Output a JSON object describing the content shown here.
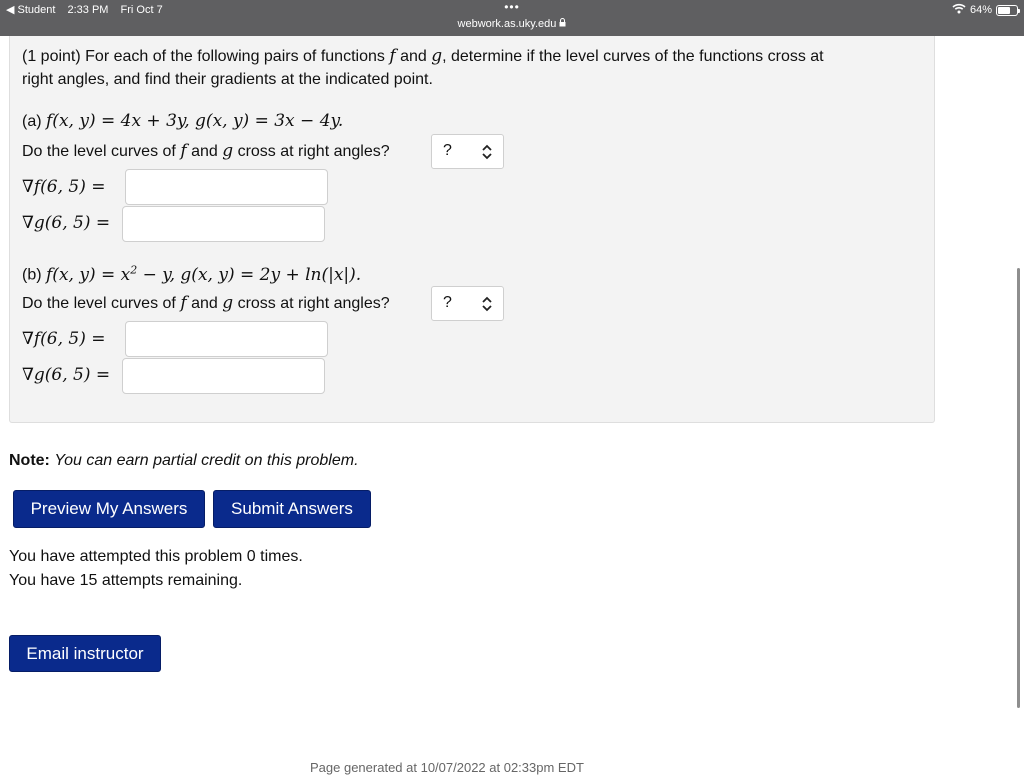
{
  "status_bar": {
    "back_label": "◀ Student",
    "time": "2:33 PM",
    "date": "Fri Oct 7",
    "dots": "•••",
    "url": "webwork.as.uky.edu",
    "lock": "🔒",
    "battery": "64%",
    "battery_level": 0.64
  },
  "problem": {
    "intro_line1": "(1 point) For each of the following pairs of functions",
    "intro_f": "f",
    "intro_and": "and",
    "intro_g": "g",
    "intro_rest": ", determine if the level curves of the functions cross at",
    "intro_line2": "right angles, and find their gradients at the indicated point.",
    "parts": [
      {
        "label": "(a)",
        "definition": "f(x, y) = 4x + 3y, g(x, y) = 3x − 4y.",
        "question_start": "Do the level curves of",
        "f": "f",
        "and": "and",
        "g": "g",
        "question_end": "cross at right angles?",
        "select_value": "?",
        "grad_f_label": "∇f(6, 5) =",
        "grad_g_label": "∇g(6, 5) ="
      },
      {
        "label": "(b)",
        "definition_pre": "f(x, y) = x",
        "definition_sup": "2",
        "definition_post": " − y, g(x, y) = 2y + ln(|x|).",
        "question_start": "Do the level curves of",
        "f": "f",
        "and": "and",
        "g": "g",
        "question_end": "cross at right angles?",
        "select_value": "?",
        "grad_f_label": "∇f(6, 5) =",
        "grad_g_label": "∇g(6, 5) ="
      }
    ]
  },
  "note": {
    "label": "Note:",
    "text": "You can earn partial credit on this problem."
  },
  "buttons": {
    "preview": "Preview My Answers",
    "submit": "Submit Answers",
    "email": "Email instructor"
  },
  "attempts": {
    "line1": "You have attempted this problem 0 times.",
    "line2": "You have 15 attempts remaining."
  },
  "footer": {
    "generated": "Page generated at 10/07/2022 at 02:33pm EDT"
  }
}
